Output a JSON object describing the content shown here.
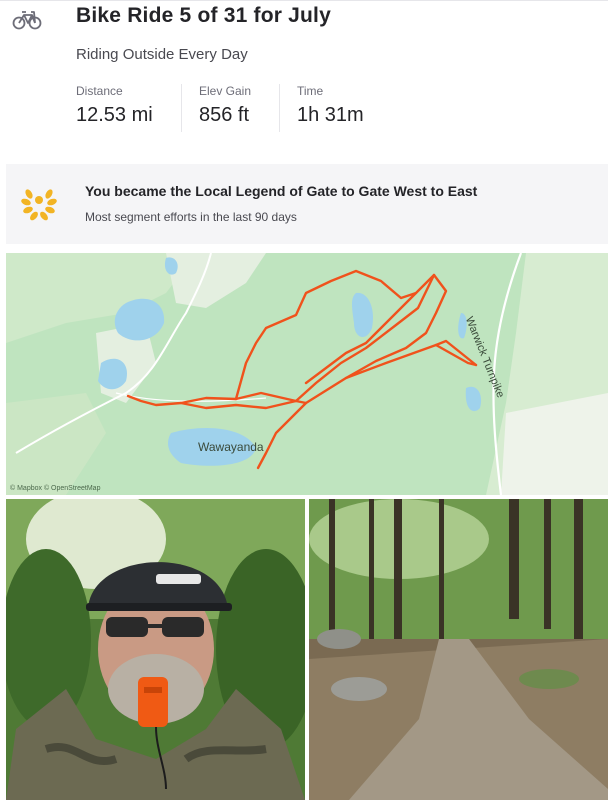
{
  "activity": {
    "icon": "bike-icon",
    "title": "Bike Ride 5 of 31 for July",
    "subtitle": "Riding Outside Every Day"
  },
  "stats": [
    {
      "label": "Distance",
      "value": "12.53 mi"
    },
    {
      "label": "Elev Gain",
      "value": "856 ft"
    },
    {
      "label": "Time",
      "value": "1h 31m"
    }
  ],
  "achievement": {
    "icon": "laurel-icon",
    "title": "You became the Local Legend of Gate to Gate West to East",
    "subtitle": "Most segment efforts in the last 90 days"
  },
  "map": {
    "place_label": "Wawayanda",
    "road_label": "Warwick Turnpike",
    "attribution": "© Mapbox © OpenStreetMap",
    "route_color": "#f0521c",
    "water_color": "#9fd2ec",
    "land_color": "#bfe4bf"
  },
  "photos": [
    {
      "name": "selfie-photo",
      "icon": "person-photo"
    },
    {
      "name": "trail-photo",
      "icon": "forest-trail-photo"
    }
  ]
}
